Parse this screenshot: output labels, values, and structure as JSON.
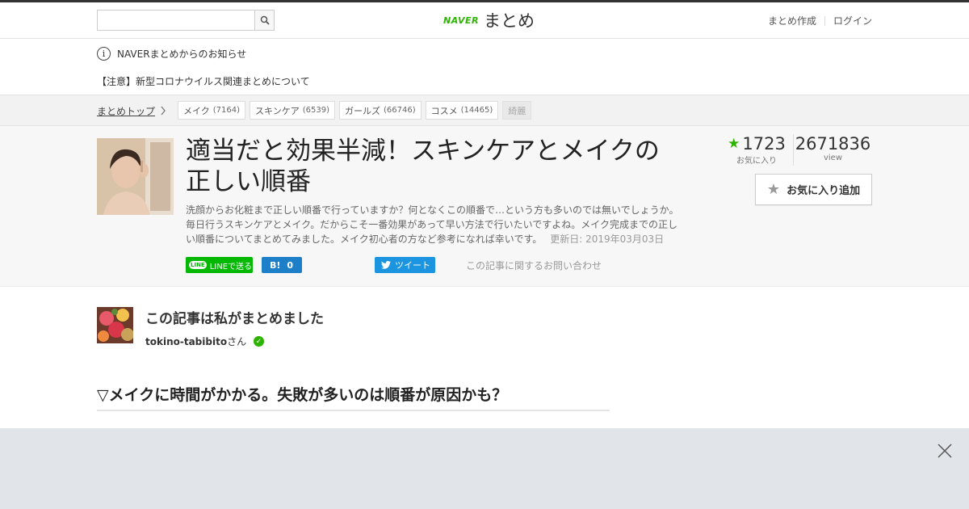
{
  "header": {
    "search_placeholder": "",
    "logo_naver": "NAVER",
    "logo_matome": "まとめ",
    "create_link": "まとめ作成",
    "login_link": "ログイン"
  },
  "notice": {
    "icon_char": "i",
    "title": "NAVERまとめからのお知らせ",
    "link": "【注意】新型コロナウイルス関連まとめについて"
  },
  "breadcrumb": {
    "home": "まとめトップ",
    "tags": [
      {
        "label": "メイク",
        "count": "(7164)"
      },
      {
        "label": "スキンケア",
        "count": "(6539)"
      },
      {
        "label": "ガールズ",
        "count": "(66746)"
      },
      {
        "label": "コスメ",
        "count": "(14465)"
      },
      {
        "label": "綺麗",
        "count": ""
      }
    ]
  },
  "article": {
    "title": "適当だと効果半減！スキンケアとメイクの正しい順番",
    "description": "洗顔からお化粧まで正しい順番で行っていますか？何となくこの順番で…という方も多いのでは無いでしょうか。毎日行うスキンケアとメイク。だからこそ一番効果があって早い方法で行いたいですよね。メイク完成までの正しい順番についてまとめてみました。メイク初心者の方など参考になれば幸いです。",
    "updated": "更新日: 2019年03月03日",
    "favorites": "1723",
    "favorites_label": "お気に入り",
    "views": "2671836",
    "views_label": "view",
    "fav_button": "お気に入り追加",
    "line_label": "LINEで送る",
    "line_badge": "LINE",
    "hatena_label": "B!",
    "hatena_count": "0",
    "tweet_label": "ツイート",
    "contact": "この記事に関するお問い合わせ"
  },
  "author": {
    "heading": "この記事は私がまとめました",
    "name": "tokino-tabibito",
    "suffix": "さん"
  },
  "section_heading": "▽メイクに時間がかかる。失敗が多いのは順番が原因かも？",
  "colors": {
    "brand_green": "#2db400",
    "line_green": "#00b900",
    "hatena_blue": "#1c7fc7",
    "twitter_blue": "#1b95e0",
    "ad_overlay_bg": "#e1e4e8"
  }
}
